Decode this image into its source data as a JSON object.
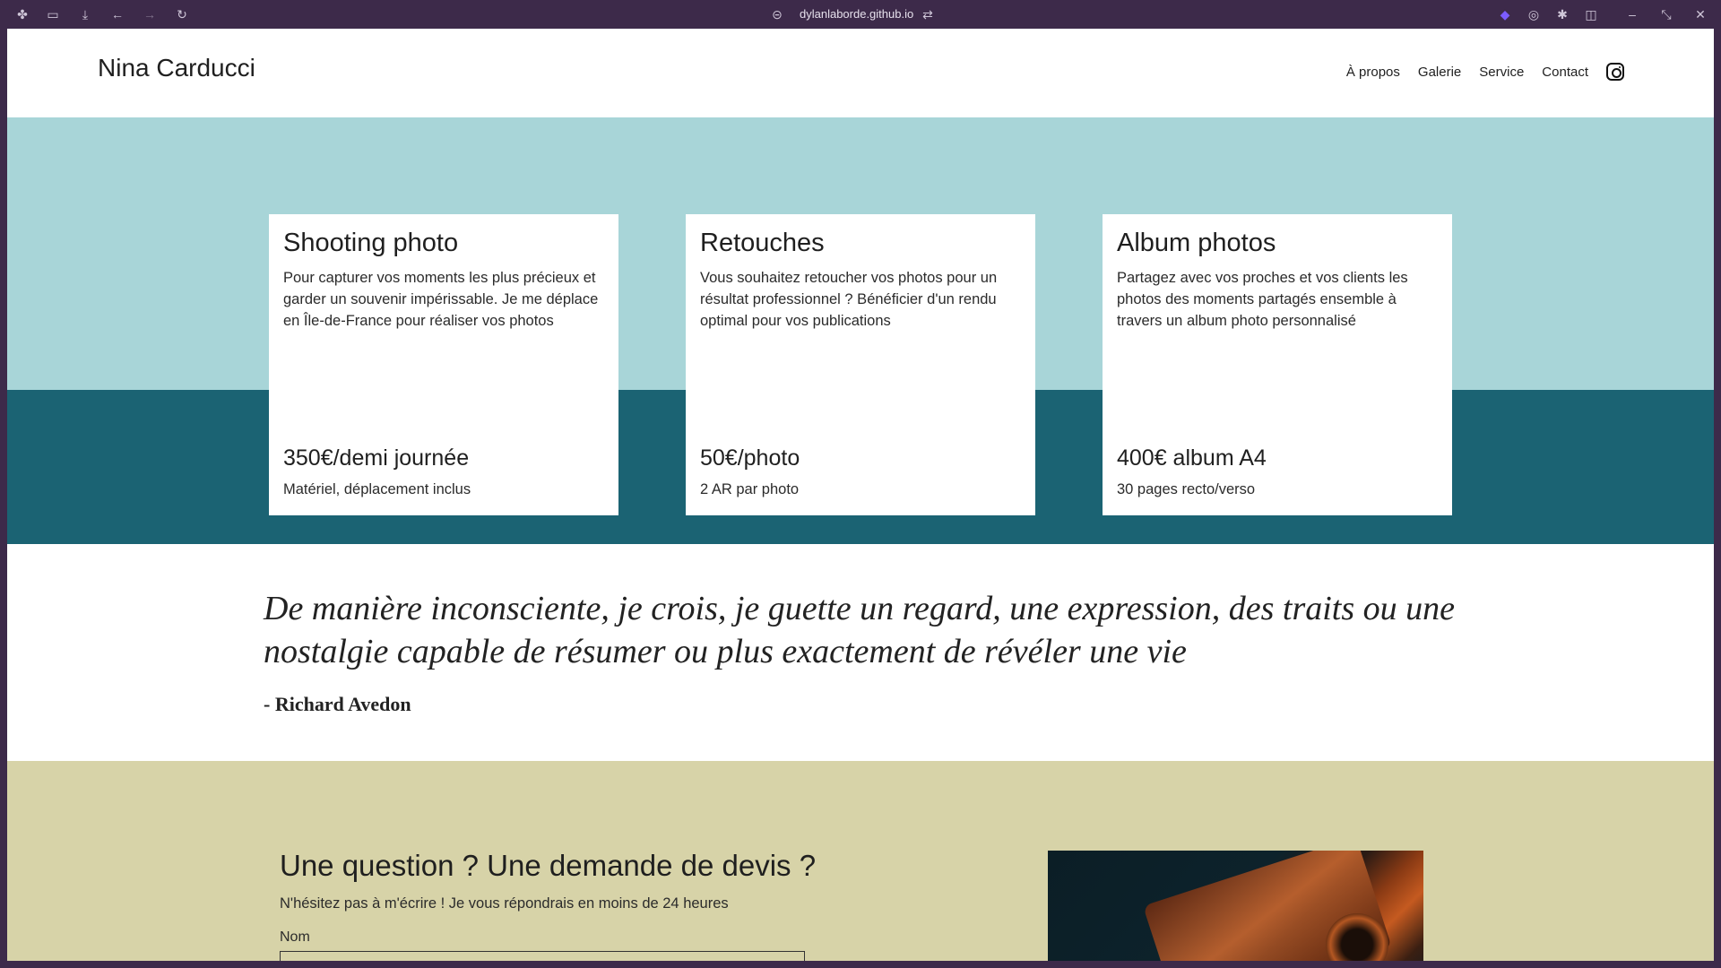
{
  "browser": {
    "url": "dylanlaborde.github.io",
    "icons": [
      "workspaces-icon",
      "sidebar-icon",
      "download-icon",
      "back-icon",
      "forward-icon",
      "reload-icon",
      "link-icon",
      "tune-icon",
      "extension-icon",
      "record-icon",
      "settings-icon",
      "split-view-icon",
      "minimize-icon",
      "restore-icon",
      "close-icon"
    ]
  },
  "header": {
    "brand": "Nina Carducci",
    "nav": [
      "À propos",
      "Galerie",
      "Service",
      "Contact"
    ],
    "social_icon": "instagram-icon"
  },
  "services": {
    "colors": {
      "top": "#a8d5d8",
      "bottom": "#1b6373"
    },
    "cards": [
      {
        "title": "Shooting photo",
        "description": "Pour capturer vos moments les plus précieux et garder un souvenir impérissable. Je me déplace en Île-de-France pour réaliser vos photos",
        "price": "350€/demi journée",
        "note": "Matériel, déplacement inclus"
      },
      {
        "title": "Retouches",
        "description": "Vous souhaitez retoucher vos photos pour un résultat professionnel ? Bénéficier d'un rendu optimal pour vos publications",
        "price": "50€/photo",
        "note": "2 AR par photo"
      },
      {
        "title": "Album photos",
        "description": "Partagez avec vos proches et vos clients les photos des moments partagés ensemble à travers un album photo personnalisé",
        "price": "400€ album A4",
        "note": "30 pages recto/verso"
      }
    ]
  },
  "quote": {
    "text": "De manière inconsciente, je crois, je guette un regard, une expression, des traits ou une nostalgie capable de résumer ou plus exactement de révéler une vie",
    "author": "- Richard Avedon"
  },
  "contact": {
    "title": "Une question ? Une demande de devis ?",
    "subtitle": "N'hésitez pas à m'écrire ! Je vous répondrais en moins de 24 heures",
    "name_label": "Nom",
    "background": "#d7d3a8"
  }
}
